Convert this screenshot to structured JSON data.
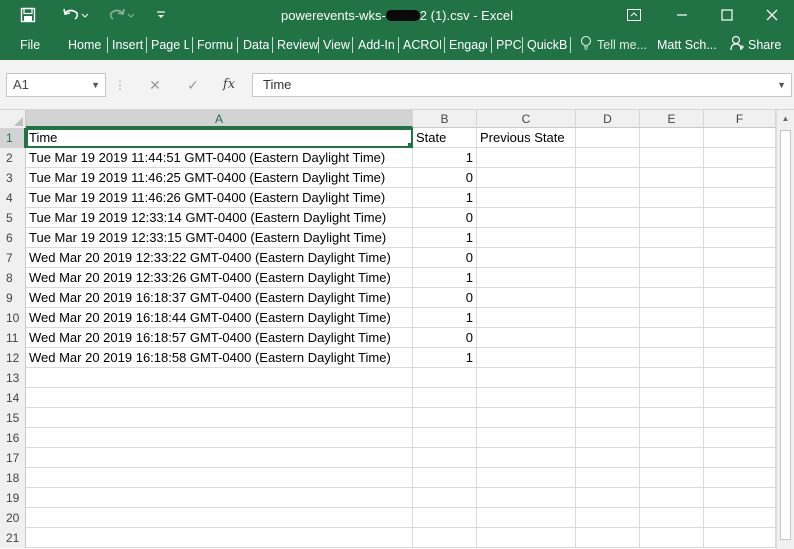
{
  "window": {
    "title_prefix": "powerevents-wks-",
    "title_suffix": "2 (1).csv - Excel",
    "accent": "#217346"
  },
  "ribbon": {
    "tabs": [
      "File",
      "Home",
      "Insert",
      "Page La",
      "Formu",
      "Data",
      "Review",
      "View",
      "Add-In",
      "ACROE",
      "Engage",
      "PPC",
      "QuickB"
    ],
    "tell_me": "Tell me...",
    "user": "Matt Sch...",
    "share": "Share"
  },
  "formula_bar": {
    "name_box": "A1",
    "cancel_icon": "✕",
    "enter_icon": "✓",
    "fx_icon": "fx",
    "value": "Time"
  },
  "sheet": {
    "columns": [
      "A",
      "B",
      "C",
      "D",
      "E",
      "F"
    ],
    "row_numbers": [
      "1",
      "2",
      "3",
      "4",
      "5",
      "6",
      "7",
      "8",
      "9",
      "10",
      "11",
      "12",
      "13",
      "14",
      "15",
      "16",
      "17",
      "18",
      "19",
      "20",
      "21"
    ],
    "headers": [
      "Time",
      "State",
      "Previous State"
    ],
    "data": [
      [
        "Tue Mar 19 2019 11:44:51 GMT-0400 (Eastern Daylight Time)",
        "1"
      ],
      [
        "Tue Mar 19 2019 11:46:25 GMT-0400 (Eastern Daylight Time)",
        "0"
      ],
      [
        "Tue Mar 19 2019 11:46:26 GMT-0400 (Eastern Daylight Time)",
        "1"
      ],
      [
        "Tue Mar 19 2019 12:33:14 GMT-0400 (Eastern Daylight Time)",
        "0"
      ],
      [
        "Tue Mar 19 2019 12:33:15 GMT-0400 (Eastern Daylight Time)",
        "1"
      ],
      [
        "Wed Mar 20 2019 12:33:22 GMT-0400 (Eastern Daylight Time)",
        "0"
      ],
      [
        "Wed Mar 20 2019 12:33:26 GMT-0400 (Eastern Daylight Time)",
        "1"
      ],
      [
        "Wed Mar 20 2019 16:18:37 GMT-0400 (Eastern Daylight Time)",
        "0"
      ],
      [
        "Wed Mar 20 2019 16:18:44 GMT-0400 (Eastern Daylight Time)",
        "1"
      ],
      [
        "Wed Mar 20 2019 16:18:57 GMT-0400 (Eastern Daylight Time)",
        "0"
      ],
      [
        "Wed Mar 20 2019 16:18:58 GMT-0400 (Eastern Daylight Time)",
        "1"
      ]
    ]
  }
}
